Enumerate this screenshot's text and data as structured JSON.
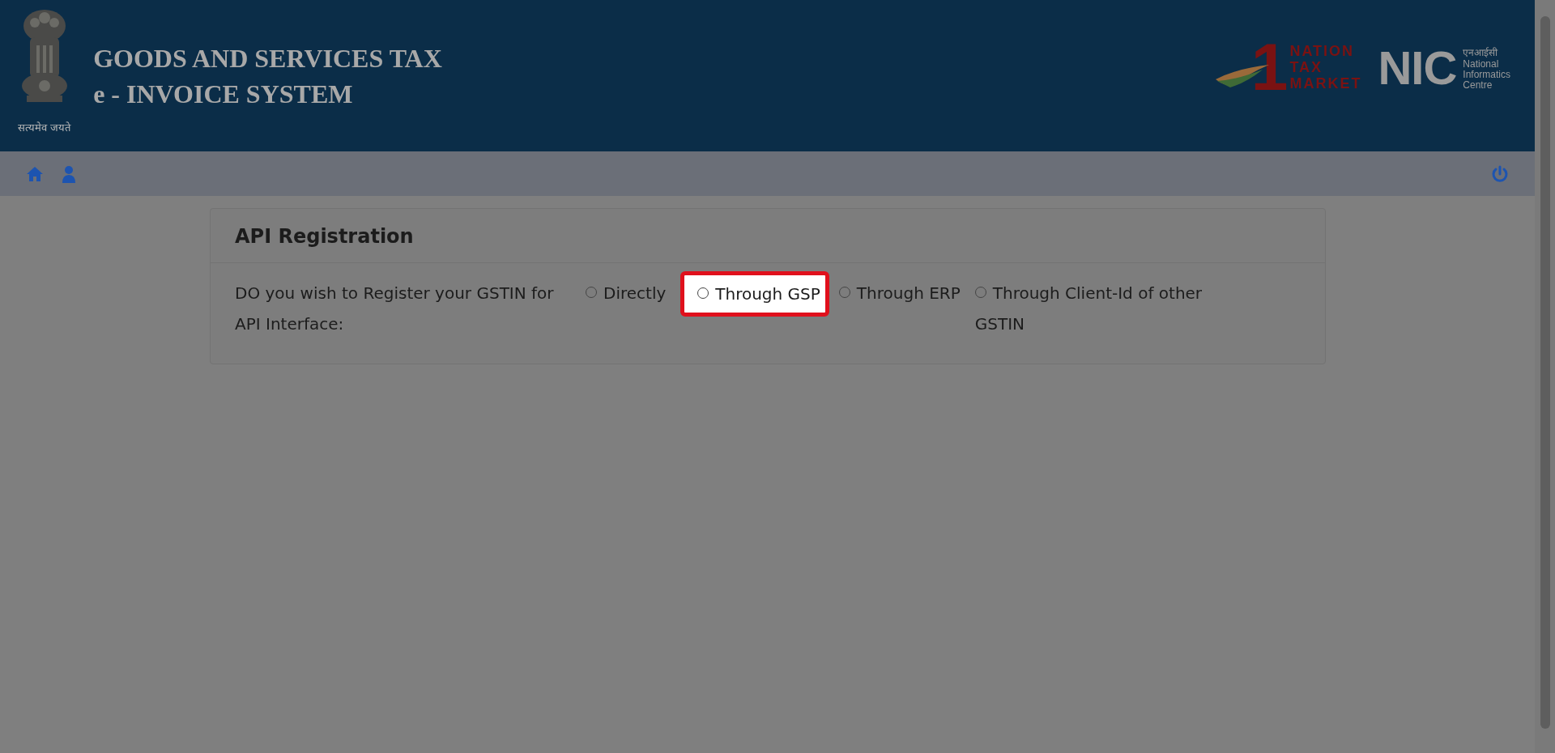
{
  "header": {
    "emblem_motto": "सत्यमेव जयते",
    "title_lines": [
      "GOODS AND SERVICES TAX",
      "e - INVOICE SYSTEM"
    ],
    "logo_one_nation": {
      "numeral": "1",
      "lines": [
        "NATION",
        "TAX",
        "MARKET"
      ]
    },
    "logo_nic": {
      "mark": "NIC",
      "hindi": "एनआईसी",
      "lines": [
        "National",
        "Informatics",
        "Centre"
      ]
    }
  },
  "card": {
    "title": "API Registration",
    "question": "DO you wish to Register your GSTIN for API Interface:",
    "options": [
      {
        "label": "Directly",
        "selected": false,
        "highlighted": false
      },
      {
        "label": "Through GSP",
        "selected": false,
        "highlighted": true
      },
      {
        "label": "Through ERP",
        "selected": false,
        "highlighted": false
      },
      {
        "label": "Through Client-Id of other GSTIN",
        "selected": false,
        "highlighted": false
      }
    ]
  }
}
